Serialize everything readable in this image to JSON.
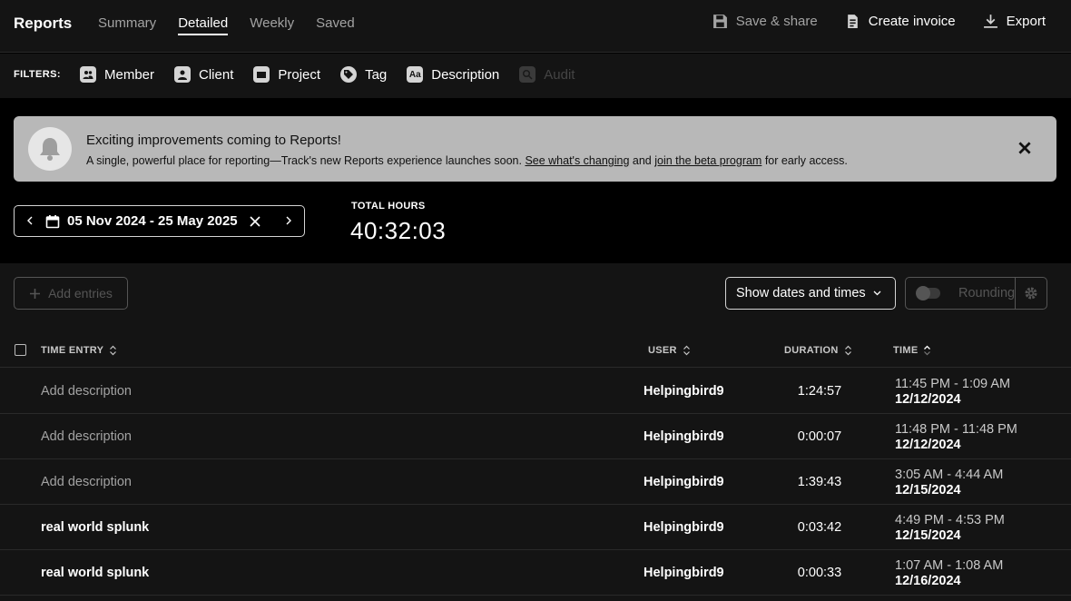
{
  "header": {
    "brand": "Reports",
    "tabs": [
      {
        "label": "Summary",
        "active": false
      },
      {
        "label": "Detailed",
        "active": true
      },
      {
        "label": "Weekly",
        "active": false
      },
      {
        "label": "Saved",
        "active": false
      }
    ],
    "actions": {
      "save_share": "Save & share",
      "create_invoice": "Create invoice",
      "export": "Export"
    }
  },
  "filters": {
    "label": "FILTERS:",
    "items": [
      {
        "label": "Member",
        "icon": "member-icon"
      },
      {
        "label": "Client",
        "icon": "client-icon"
      },
      {
        "label": "Project",
        "icon": "project-icon"
      },
      {
        "label": "Tag",
        "icon": "tag-icon"
      },
      {
        "label": "Description",
        "icon": "description-icon",
        "glyph": "Aa"
      },
      {
        "label": "Audit",
        "icon": "audit-icon",
        "disabled": true
      }
    ]
  },
  "banner": {
    "title": "Exciting improvements coming to Reports!",
    "text_before": "A single, powerful place for reporting—Track's new Reports experience launches soon. ",
    "link1": "See what's changing",
    "text_mid": " and ",
    "link2": "join the beta program",
    "text_after": " for early access."
  },
  "date_range": {
    "value": "05 Nov 2024 - 25 May 2025"
  },
  "total": {
    "label": "TOTAL HOURS",
    "value": "40:32:03"
  },
  "toolbar": {
    "add_entries": "Add entries",
    "show_dates": "Show dates and times",
    "rounding": "Rounding"
  },
  "table": {
    "columns": {
      "entry": "TIME ENTRY",
      "user": "USER",
      "duration": "DURATION",
      "time": "TIME"
    },
    "rows": [
      {
        "description": "Add description",
        "placeholder": true,
        "user": "Helpingbird9",
        "duration": "1:24:57",
        "time": "11:45 PM - 1:09 AM",
        "date": "12/12/2024"
      },
      {
        "description": "Add description",
        "placeholder": true,
        "user": "Helpingbird9",
        "duration": "0:00:07",
        "time": "11:48 PM - 11:48 PM",
        "date": "12/12/2024"
      },
      {
        "description": "Add description",
        "placeholder": true,
        "user": "Helpingbird9",
        "duration": "1:39:43",
        "time": "3:05 AM - 4:44 AM",
        "date": "12/15/2024"
      },
      {
        "description": "real world splunk",
        "placeholder": false,
        "user": "Helpingbird9",
        "duration": "0:03:42",
        "time": "4:49 PM - 4:53 PM",
        "date": "12/15/2024"
      },
      {
        "description": "real world splunk",
        "placeholder": false,
        "user": "Helpingbird9",
        "duration": "0:00:33",
        "time": "1:07 AM - 1:08 AM",
        "date": "12/16/2024"
      }
    ]
  }
}
